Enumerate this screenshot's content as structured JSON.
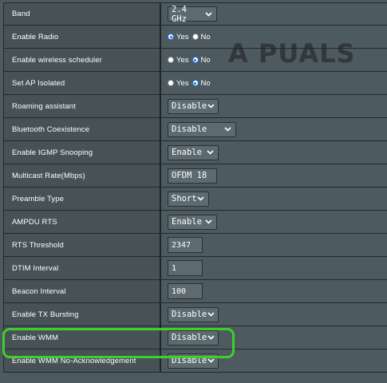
{
  "rows": [
    {
      "label": "Band",
      "control": "select",
      "value": "2.4 GHz"
    },
    {
      "label": "Enable Radio",
      "control": "radio",
      "options": [
        "Yes",
        "No"
      ],
      "selected": "Yes"
    },
    {
      "label": "Enable wireless scheduler",
      "control": "radio",
      "options": [
        "Yes",
        "No"
      ],
      "selected": "No"
    },
    {
      "label": "Set AP Isolated",
      "control": "radio",
      "options": [
        "Yes",
        "No"
      ],
      "selected": "No"
    },
    {
      "label": "Roaming assistant",
      "control": "select",
      "value": "Disable"
    },
    {
      "label": "Bluetooth Coexistence",
      "control": "select",
      "value": "Disable"
    },
    {
      "label": "Enable IGMP Snooping",
      "control": "select",
      "value": "Enable"
    },
    {
      "label": "Multicast Rate(Mbps)",
      "control": "select",
      "value": "OFDM 18"
    },
    {
      "label": "Preamble Type",
      "control": "select",
      "value": "Short"
    },
    {
      "label": "AMPDU RTS",
      "control": "select",
      "value": "Enable"
    },
    {
      "label": "RTS Threshold",
      "control": "input",
      "value": "2347"
    },
    {
      "label": "DTIM Interval",
      "control": "input",
      "value": "1"
    },
    {
      "label": "Beacon Interval",
      "control": "input",
      "value": "100"
    },
    {
      "label": "Enable TX Bursting",
      "control": "select",
      "value": "Disable"
    },
    {
      "label": "Enable WMM",
      "control": "select",
      "value": "Disable"
    },
    {
      "label": "Enable WMM No-Acknowledgement",
      "control": "select",
      "value": "Disable"
    }
  ],
  "watermark": {
    "text": "A PUALS"
  },
  "colors": {
    "highlight": "#3ed02a",
    "radio_selected": "#1e73d8",
    "background": "#4d5a5f"
  }
}
